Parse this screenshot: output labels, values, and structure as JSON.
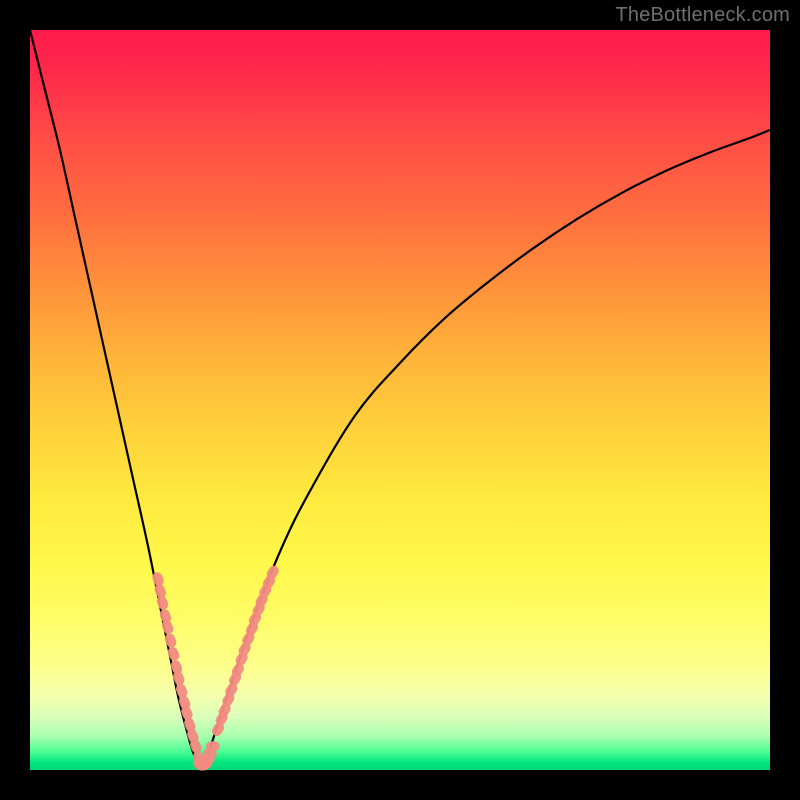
{
  "watermark": {
    "text": "TheBottleneck.com"
  },
  "chart_data": {
    "type": "line",
    "title": "",
    "xlabel": "",
    "ylabel": "",
    "xlim": [
      0,
      100
    ],
    "ylim": [
      0,
      100
    ],
    "grid": false,
    "legend": false,
    "note": "Axes are unlabeled percentage scales 0–100. Curve is a V-shaped profile touching zero near x≈23, rising steeply toward the left edge and more gradually toward the right edge. Coral-colored clusters of points sit on the curve near the valley.",
    "series": [
      {
        "name": "curve",
        "stroke": "#000000",
        "x": [
          0,
          2,
          4,
          6,
          8,
          10,
          12,
          14,
          16,
          18,
          19,
          20,
          21,
          22,
          23,
          24,
          25,
          26,
          28,
          30,
          34,
          38,
          44,
          50,
          56,
          62,
          68,
          74,
          80,
          86,
          92,
          97,
          100
        ],
        "y": [
          100,
          92,
          84,
          75,
          66,
          57,
          48,
          39,
          30,
          20,
          15,
          10,
          6,
          2.5,
          0.5,
          2,
          5,
          8,
          14,
          20,
          30,
          38,
          48,
          55,
          61,
          66,
          70.5,
          74.5,
          78,
          81,
          83.5,
          85.3,
          86.5
        ]
      }
    ],
    "markers": [
      {
        "name": "left-cluster",
        "color": "#f28b82",
        "points": [
          [
            17.3,
            25.8
          ],
          [
            17.6,
            24.2
          ],
          [
            17.9,
            22.6
          ],
          [
            18.3,
            20.8
          ],
          [
            18.6,
            19.3
          ],
          [
            19.0,
            17.5
          ],
          [
            19.4,
            15.7
          ],
          [
            19.8,
            13.9
          ],
          [
            20.1,
            12.4
          ],
          [
            20.5,
            10.7
          ],
          [
            20.9,
            9.1
          ],
          [
            21.2,
            7.7
          ],
          [
            21.6,
            6.1
          ],
          [
            22.0,
            4.6
          ],
          [
            22.4,
            3.2
          ]
        ]
      },
      {
        "name": "valley-cluster",
        "color": "#f28b82",
        "points": [
          [
            22.8,
            1.6
          ],
          [
            23.0,
            0.9
          ],
          [
            23.3,
            0.6
          ],
          [
            23.7,
            0.9
          ],
          [
            24.0,
            1.5
          ],
          [
            24.3,
            2.2
          ],
          [
            24.7,
            3.2
          ]
        ]
      },
      {
        "name": "right-cluster",
        "color": "#f28b82",
        "points": [
          [
            25.4,
            5.5
          ],
          [
            25.9,
            6.9
          ],
          [
            26.3,
            8.1
          ],
          [
            26.8,
            9.5
          ],
          [
            27.2,
            10.8
          ],
          [
            27.7,
            12.3
          ],
          [
            28.1,
            13.5
          ],
          [
            28.6,
            15.0
          ],
          [
            29.0,
            16.3
          ],
          [
            29.5,
            17.7
          ],
          [
            30.0,
            19.1
          ],
          [
            30.4,
            20.4
          ],
          [
            30.9,
            21.7
          ],
          [
            31.3,
            22.9
          ],
          [
            31.8,
            24.2
          ],
          [
            32.3,
            25.4
          ],
          [
            32.8,
            26.7
          ]
        ]
      }
    ]
  }
}
